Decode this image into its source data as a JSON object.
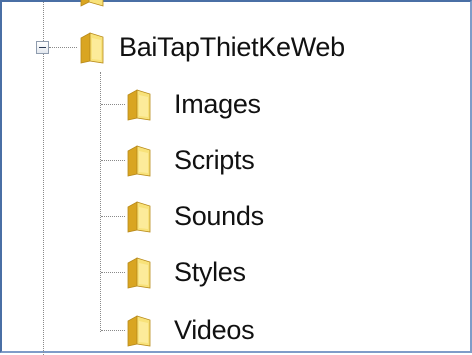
{
  "tree": {
    "root": {
      "label": "BaiTapThietKeWeb",
      "expanded": true,
      "icon": "folder-icon",
      "children": [
        {
          "label": "Images",
          "icon": "folder-icon"
        },
        {
          "label": "Scripts",
          "icon": "folder-icon"
        },
        {
          "label": "Sounds",
          "icon": "folder-icon"
        },
        {
          "label": "Styles",
          "icon": "folder-icon"
        },
        {
          "label": "Videos",
          "icon": "folder-icon"
        }
      ]
    }
  },
  "colors": {
    "folder_light": "#f8e27a",
    "folder_dark": "#d9a521",
    "folder_edge": "#b88a1a",
    "tree_line": "#8a8a8a",
    "frame_border": "#4a6fa5"
  }
}
